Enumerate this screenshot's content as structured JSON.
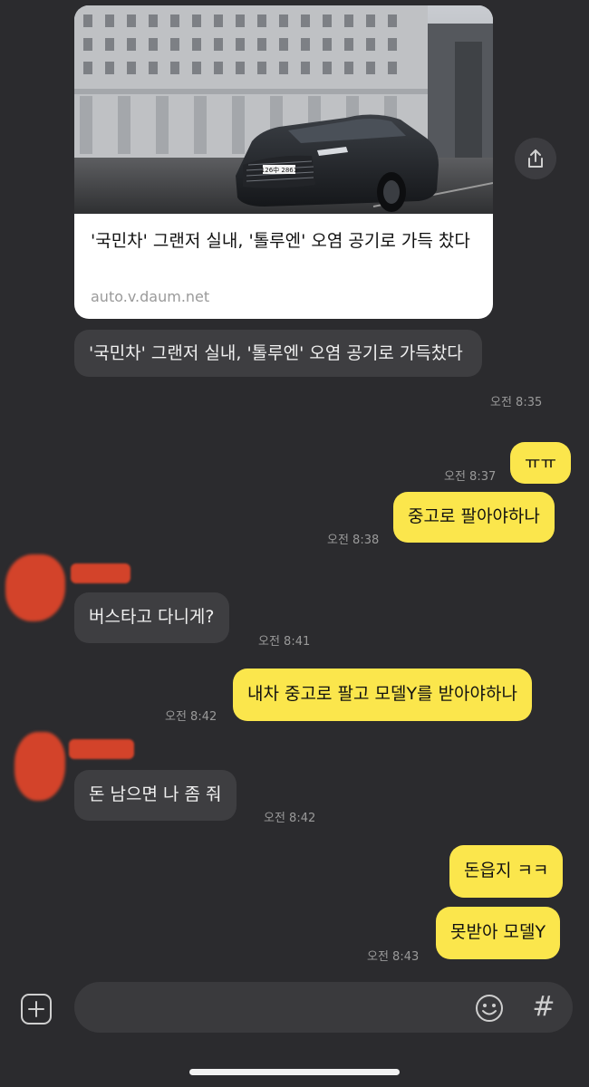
{
  "link_preview": {
    "title": "'국민차' 그랜저 실내, '톨루엔' 오염 공기로 가득 찼다",
    "domain": "auto.v.daum.net",
    "plate_text": "126中 2861"
  },
  "messages": [
    {
      "id": "m1",
      "side": "in",
      "text": "'국민차' 그랜저 실내, '톨루엔' 오염 공기로 가득찼다",
      "time": "오전 8:35"
    },
    {
      "id": "m2",
      "side": "out",
      "text": "ㅠㅠ",
      "time": "오전 8:37"
    },
    {
      "id": "m3",
      "side": "out",
      "text": "중고로 팔아야하나",
      "time": "오전 8:38"
    },
    {
      "id": "m4",
      "side": "in",
      "text": "버스타고 다니게?",
      "time": "오전 8:41"
    },
    {
      "id": "m5",
      "side": "out",
      "text": "내차 중고로 팔고 모델Y를 받아야하나",
      "time": "오전 8:42"
    },
    {
      "id": "m6",
      "side": "in",
      "text": "돈 남으면 나 좀 줘",
      "time": "오전 8:42"
    },
    {
      "id": "m7",
      "side": "out",
      "text": "돈읍지 ㅋㅋ",
      "time": ""
    },
    {
      "id": "m8",
      "side": "out",
      "text": "못받아 모델Y",
      "time": "오전 8:43"
    }
  ],
  "input_bar": {
    "hash_label": "#",
    "icons": [
      "plus-icon",
      "emoji-icon",
      "hash-icon",
      "share-icon"
    ]
  },
  "colors": {
    "background": "#2b2b2e",
    "incoming_bubble": "#3e3e41",
    "outgoing_bubble": "#fbe64c",
    "redaction": "#d3432a"
  }
}
